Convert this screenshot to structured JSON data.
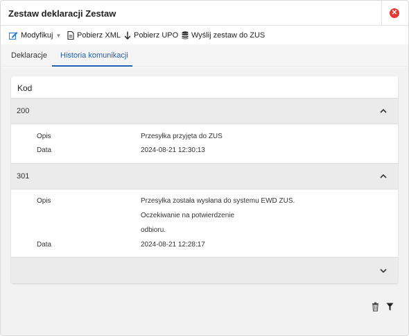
{
  "dialog": {
    "title": "Zestaw deklaracji Zestaw",
    "close_icon": "close-icon",
    "accent_color": "#e53935"
  },
  "toolbar": {
    "modify_label": "Modyfikuj",
    "download_xml_label": "Pobierz XML",
    "download_upo_label": "Pobierz UPO",
    "send_label": "Wyślij zestaw do ZUS"
  },
  "tabs": [
    {
      "label": "Deklaracje",
      "active": false
    },
    {
      "label": "Historia komunikacji",
      "active": true
    }
  ],
  "history": {
    "column_header": "Kod",
    "groups": [
      {
        "code": "200",
        "expanded": true,
        "rows": [
          {
            "label": "Opis",
            "value_lines": [
              "Przesyłka przyjęta do ZUS"
            ]
          },
          {
            "label": "Data",
            "value_lines": [
              "2024-08-21 12:30:13"
            ]
          }
        ]
      },
      {
        "code": "301",
        "expanded": true,
        "rows": [
          {
            "label": "Opis",
            "value_lines": [
              "Przesyłka została wysłana do systemu EWD ZUS.",
              "Oczekiwanie na potwierdzenie",
              "odbioru."
            ]
          },
          {
            "label": "Data",
            "value_lines": [
              "2024-08-21 12:28:17"
            ]
          }
        ]
      },
      {
        "code": "",
        "expanded": false,
        "rows": []
      }
    ]
  },
  "footer_icons": [
    "trash-icon",
    "filter-icon"
  ],
  "colors": {
    "link_blue": "#1e5fb4",
    "group_bg": "#ebebeb",
    "content_bg": "#f2f2f2"
  }
}
